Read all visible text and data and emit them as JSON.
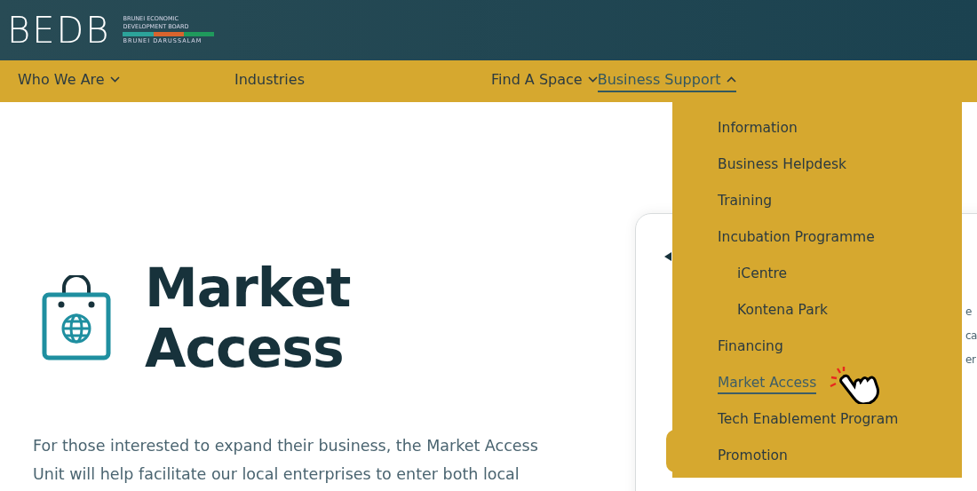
{
  "header": {
    "logo": "BEDB",
    "org_line_1": "BRUNEI ECONOMIC",
    "org_line_2": "DEVELOPMENT BOARD",
    "org_line_3": "BRUNEI DARUSSALAM"
  },
  "nav": [
    {
      "label": "Who We Are",
      "has_menu": true,
      "expanded": false,
      "selected": false
    },
    {
      "label": "Industries",
      "has_menu": false,
      "selected": false
    },
    {
      "label": "Find A Space",
      "has_menu": true,
      "expanded": false,
      "selected": false
    },
    {
      "label": "Business Support",
      "has_menu": true,
      "expanded": true,
      "selected": true
    }
  ],
  "dropdown": [
    {
      "label": "Information",
      "selected": false
    },
    {
      "label": "Business Helpdesk",
      "selected": false
    },
    {
      "label": "Training",
      "selected": false
    },
    {
      "label": "Incubation Programme",
      "selected": false,
      "children": [
        {
          "label": "iCentre",
          "selected": false
        },
        {
          "label": "Kontena Park",
          "selected": false
        }
      ]
    },
    {
      "label": "Financing",
      "selected": false
    },
    {
      "label": "Market Access",
      "selected": true
    },
    {
      "label": "Tech Enablement Program",
      "selected": false
    },
    {
      "label": "Promotion",
      "selected": false
    }
  ],
  "hero": {
    "title": "Market Access",
    "intro": "For those interested to expand their business, the Market Access Unit will help facilitate our local enterprises to enter both local"
  },
  "card": {
    "fragments": [
      "e",
      "ca",
      "er"
    ]
  }
}
